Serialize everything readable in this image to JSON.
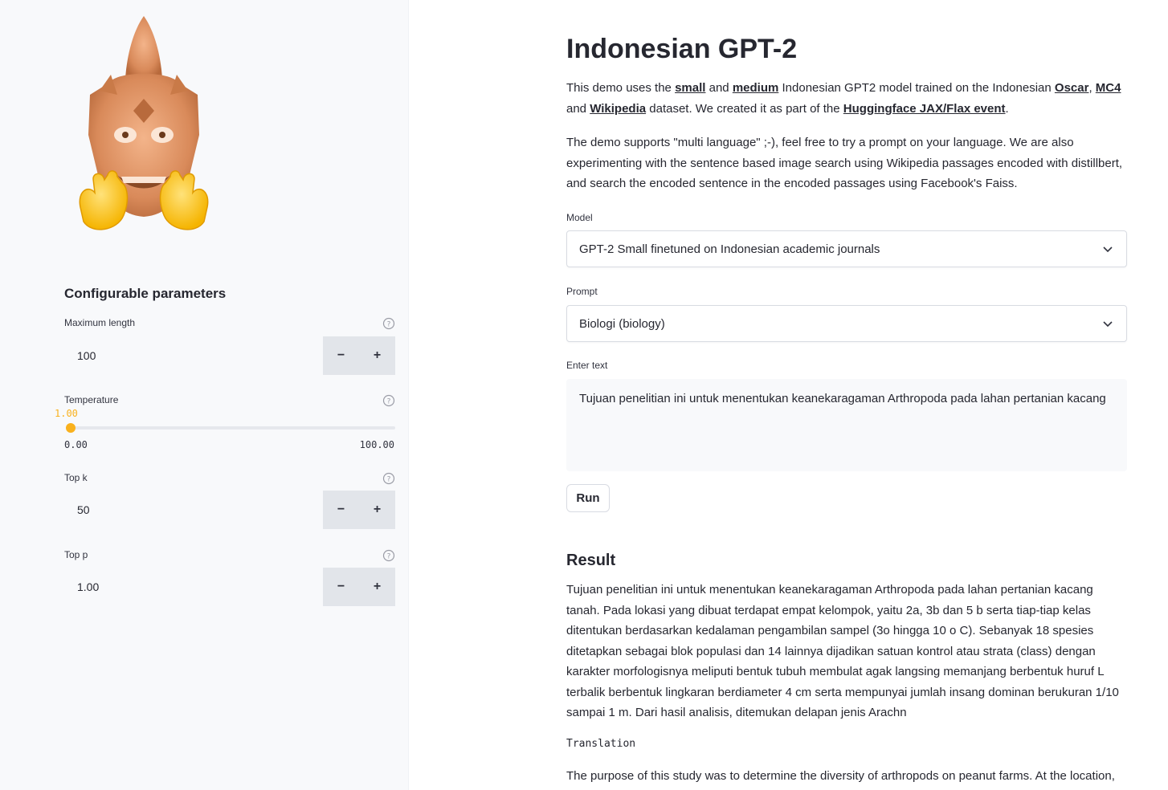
{
  "sidebar": {
    "logo_name": "garuda-mask-with-clapping-hands-logo",
    "title": "Configurable parameters",
    "max_length": {
      "label": "Maximum length",
      "value": "100",
      "minus": "−",
      "plus": "+"
    },
    "temperature": {
      "label": "Temperature",
      "value": "1.00",
      "min": "0.00",
      "max": "100.00",
      "fraction": 0.01
    },
    "top_k": {
      "label": "Top k",
      "value": "50",
      "minus": "−",
      "plus": "+"
    },
    "top_p": {
      "label": "Top p",
      "value": "1.00",
      "minus": "−",
      "plus": "+"
    }
  },
  "main": {
    "title": "Indonesian GPT-2",
    "intro": {
      "t1": "This demo uses the ",
      "link_small": "small",
      "t2": " and ",
      "link_medium": "medium",
      "t3": " Indonesian GPT2 model trained on the Indonesian ",
      "link_oscar": "Oscar",
      "t4": ", ",
      "link_mc4": "MC4",
      "t5": " and ",
      "link_wikipedia": "Wikipedia",
      "t6": " dataset. We created it as part of the ",
      "link_event": "Huggingface JAX/Flax event",
      "t7": "."
    },
    "description": "The demo supports \"multi language\" ;-), feel free to try a prompt on your language. We are also experimenting with the sentence based image search using Wikipedia passages encoded with distillbert, and search the encoded sentence in the encoded passages using Facebook's Faiss.",
    "model_label": "Model",
    "model_value": "GPT-2 Small finetuned on Indonesian academic journals",
    "prompt_label": "Prompt",
    "prompt_value": "Biologi (biology)",
    "enter_text_label": "Enter text",
    "enter_text_value": "Tujuan  penelitian ini untuk menentukan keanekaragaman Arthropoda pada lahan pertanian kacang",
    "run_label": "Run",
    "result_title": "Result",
    "result_text": "Tujuan penelitian ini untuk menentukan keanekaragaman Arthropoda pada lahan pertanian kacang tanah. Pada lokasi yang dibuat terdapat empat kelompok, yaitu 2a, 3b dan 5 b serta tiap-tiap kelas ditentukan berdasarkan kedalaman pengambilan sampel (3o hingga 10 o C). Sebanyak 18 spesies ditetapkan sebagai blok populasi dan 14 lainnya dijadikan satuan kontrol atau strata (class) dengan karakter morfologisnya meliputi bentuk tubuh membulat agak langsing memanjang berbentuk huruf L terbalik berbentuk lingkaran berdiameter 4 cm serta mempunyai jumlah insang dominan berukuran 1/10 sampai 1 m. Dari hasil analisis, ditemukan delapan jenis Arachn",
    "translation_label": "Translation",
    "translation_text": "The purpose of this study was to determine the diversity of arthropods on peanut farms. At the location,"
  },
  "colors": {
    "accent": "#f9b11d",
    "text": "#262730",
    "sidebar_bg": "#f8f9fb",
    "stepper_bg": "#e2e5ea"
  }
}
